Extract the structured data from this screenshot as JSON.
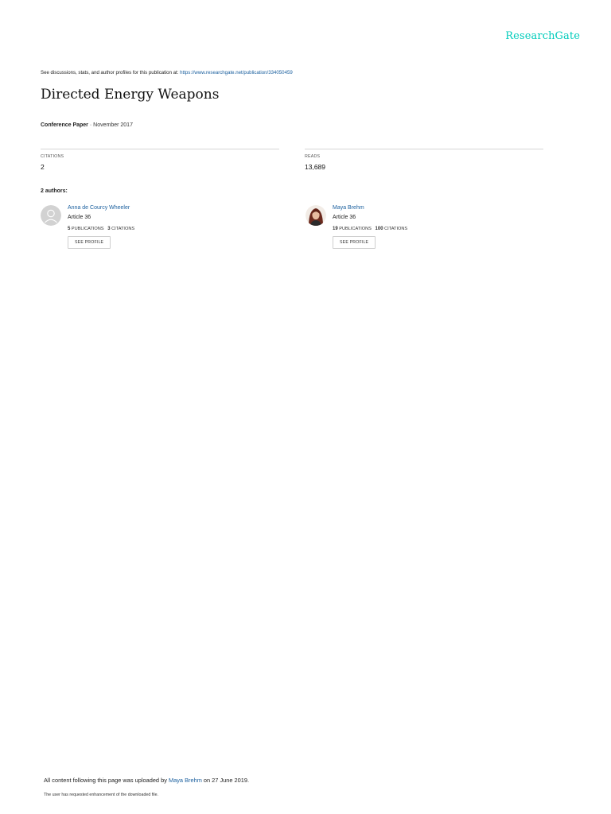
{
  "brand": {
    "logo": "ResearchGate"
  },
  "header": {
    "discuss_text": "See discussions, stats, and author profiles for this publication at: ",
    "discuss_url": "https://www.researchgate.net/publication/334050459"
  },
  "publication": {
    "title": "Directed Energy Weapons",
    "type": "Conference Paper",
    "separator": " · ",
    "date": "November 2017"
  },
  "stats": {
    "citations_label": "CITATIONS",
    "citations_value": "2",
    "reads_label": "READS",
    "reads_value": "13,689"
  },
  "authors_heading": "2 authors:",
  "authors": [
    {
      "name": "Anna de Courcy Wheeler",
      "affiliation": "Article 36",
      "publications_count": "5",
      "publications_label": "PUBLICATIONS",
      "citations_count": "3",
      "citations_label": "CITATIONS",
      "button_label": "SEE PROFILE"
    },
    {
      "name": "Maya Brehm",
      "affiliation": "Article 36",
      "publications_count": "19",
      "publications_label": "PUBLICATIONS",
      "citations_count": "100",
      "citations_label": "CITATIONS",
      "button_label": "SEE PROFILE"
    }
  ],
  "footer": {
    "uploaded_prefix": "All content following this page was uploaded by ",
    "uploader": "Maya Brehm",
    "uploaded_suffix": " on 27 June 2019.",
    "enhancement_note": "The user has requested enhancement of the downloaded file."
  },
  "colors": {
    "brand": "#00ccbb",
    "link": "#1a5f9e",
    "divider": "#d6d6d6"
  }
}
